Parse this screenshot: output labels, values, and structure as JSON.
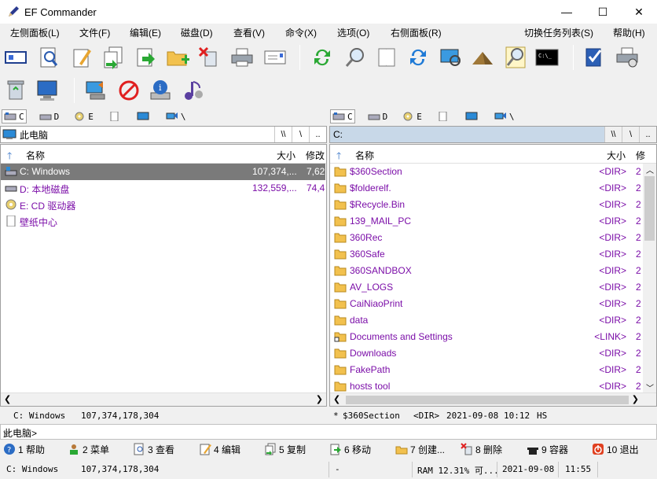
{
  "window": {
    "title": "EF Commander",
    "min": "—",
    "max": "☐",
    "close": "✕"
  },
  "menu": [
    "左侧面板(L)",
    "文件(F)",
    "编辑(E)",
    "磁盘(D)",
    "查看(V)",
    "命令(X)",
    "选项(O)",
    "右侧面板(R)",
    "切换任务列表(S)",
    "帮助(H)"
  ],
  "drives": [
    {
      "label": "C",
      "icon": "drive-c-icon"
    },
    {
      "label": "D",
      "icon": "drive-d-icon"
    },
    {
      "label": "E",
      "icon": "cd-drive-icon"
    },
    {
      "label": "",
      "icon": "document-icon"
    },
    {
      "label": "",
      "icon": "monitor-icon"
    },
    {
      "label": "\\",
      "icon": "network-icon"
    }
  ],
  "left": {
    "path": "此电脑",
    "path_btn1": "\\\\",
    "path_btn2": "\\",
    "path_btn3": "..",
    "headers": {
      "name": "名称",
      "size": "大小",
      "modified": "修改"
    },
    "rows": [
      {
        "name": "C: Windows",
        "size": "107,374,...",
        "mod": "7,62",
        "icon": "hdd-windows-icon"
      },
      {
        "name": "D: 本地磁盘",
        "size": "132,559,...",
        "mod": "74,4",
        "icon": "hdd-icon"
      },
      {
        "name": "E: CD 驱动器",
        "size": "",
        "mod": "",
        "icon": "cd-icon"
      },
      {
        "name": "壁纸中心",
        "size": "",
        "mod": "",
        "icon": "file-icon"
      }
    ],
    "status": {
      "name": "C: Windows",
      "size": "107,374,178,304"
    }
  },
  "right": {
    "path": "C:",
    "path_btn1": "\\\\",
    "path_btn2": "\\",
    "path_btn3": "..",
    "headers": {
      "name": "名称",
      "size": "大小",
      "modified": "修"
    },
    "rows": [
      {
        "name": "$360Section",
        "size": "<DIR>",
        "mod": "2"
      },
      {
        "name": "$folderelf.",
        "size": "<DIR>",
        "mod": "2"
      },
      {
        "name": "$Recycle.Bin",
        "size": "<DIR>",
        "mod": "2"
      },
      {
        "name": "139_MAIL_PC",
        "size": "<DIR>",
        "mod": "2"
      },
      {
        "name": "360Rec",
        "size": "<DIR>",
        "mod": "2"
      },
      {
        "name": "360Safe",
        "size": "<DIR>",
        "mod": "2"
      },
      {
        "name": "360SANDBOX",
        "size": "<DIR>",
        "mod": "2"
      },
      {
        "name": "AV_LOGS",
        "size": "<DIR>",
        "mod": "2"
      },
      {
        "name": "CaiNiaoPrint",
        "size": "<DIR>",
        "mod": "2"
      },
      {
        "name": "data",
        "size": "<DIR>",
        "mod": "2"
      },
      {
        "name": "Documents and Settings",
        "size": "<LINK>",
        "mod": "2"
      },
      {
        "name": "Downloads",
        "size": "<DIR>",
        "mod": "2"
      },
      {
        "name": "FakePath",
        "size": "<DIR>",
        "mod": "2"
      },
      {
        "name": "hosts tool",
        "size": "<DIR>",
        "mod": "2"
      }
    ],
    "status": {
      "marker": "*",
      "name": "$360Section",
      "type": "<DIR>",
      "date": "2021-09-08",
      "time": "10:12",
      "attr": "HS"
    }
  },
  "cmdline": {
    "text": "此电脑>",
    "dropdown": "⌵"
  },
  "fkeys": [
    {
      "label": "1 帮助",
      "icon": "help-icon"
    },
    {
      "label": "2 菜单",
      "icon": "user-menu-icon"
    },
    {
      "label": "3 查看",
      "icon": "view-icon"
    },
    {
      "label": "4 编辑",
      "icon": "edit-icon"
    },
    {
      "label": "5 复制",
      "icon": "copy-icon"
    },
    {
      "label": "6 移动",
      "icon": "move-icon"
    },
    {
      "label": "7 创建...",
      "icon": "create-folder-icon"
    },
    {
      "label": "8 删除",
      "icon": "delete-icon"
    },
    {
      "label": "9 容器",
      "icon": "container-icon"
    },
    {
      "label": "10 退出",
      "icon": "exit-icon"
    }
  ],
  "bottom": {
    "drive": "C: Windows",
    "size": "107,374,178,304",
    "dash": "-",
    "ram": "RAM 12.31% 可...",
    "date": "2021-09-08",
    "time": "11:55"
  },
  "toolbar1_icons": [
    "drive-info-icon",
    "view-icon",
    "edit-icon",
    "copy-icon",
    "move-icon",
    "new-folder-icon",
    "delete-icon",
    "print-icon",
    "email-icon",
    "refresh-icon",
    "search-icon",
    "compare-icon",
    "sync-icon",
    "network-search-icon",
    "pyramid-icon",
    "find-file-icon",
    "terminal-icon",
    "check-icon",
    "print-preview-icon"
  ],
  "toolbar2_icons": [
    "recycle-bin-icon",
    "monitor-icon",
    "network-drive-icon",
    "disconnect-icon",
    "properties-icon",
    "music-icon"
  ],
  "colors": {
    "purple": "#7b0ea8",
    "selected": "#7a7a7a",
    "folder": "#f2c14e"
  }
}
